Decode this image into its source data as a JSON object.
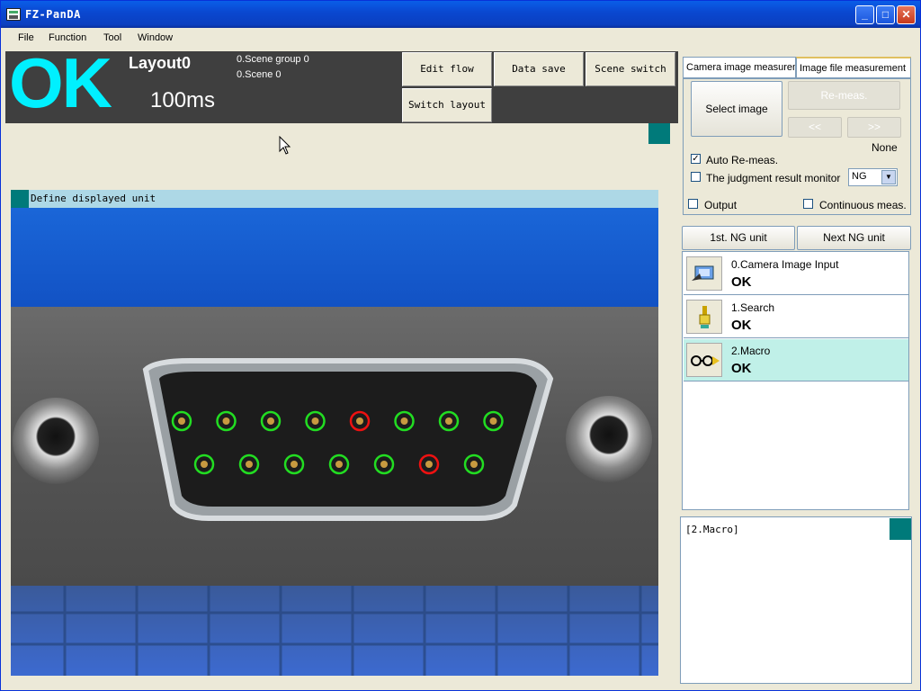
{
  "window": {
    "title": "FZ-PanDA",
    "min": "_",
    "max": "□",
    "close": "✕"
  },
  "menu": [
    "File",
    "Function",
    "Tool",
    "Window"
  ],
  "status": {
    "judgement": "OK",
    "layout": "Layout0",
    "time": "100ms",
    "scene_group": "0.Scene group 0",
    "scene": "0.Scene 0"
  },
  "toolbar": {
    "edit_flow": "Edit flow",
    "data_save": "Data save",
    "scene_switch": "Scene switch",
    "switch_layout": "Switch layout"
  },
  "image_window": {
    "title": "Define displayed unit"
  },
  "measure_tabs": [
    "Camera image measurement",
    "Image file measurement"
  ],
  "image_file_panel": {
    "select_image": "Select image",
    "re_meas": "Re-meas.",
    "prev": "<<",
    "next": ">>",
    "file_name": "None",
    "auto_remeas": "Auto Re-meas.",
    "auto_remeas_checked": true,
    "judgment_monitor": "The judgment result monitor",
    "judgment_monitor_checked": false,
    "judgment_value": "NG"
  },
  "output": {
    "label": "Output",
    "checked": false
  },
  "continuous": {
    "label": "Continuous meas.",
    "checked": false
  },
  "ng_nav": {
    "first": "1st. NG unit",
    "next": "Next NG unit"
  },
  "units": [
    {
      "name": "0.Camera Image Input",
      "result": "OK",
      "icon": "camera-input-icon"
    },
    {
      "name": "1.Search",
      "result": "OK",
      "icon": "search-unit-icon"
    },
    {
      "name": "2.Macro",
      "result": "OK",
      "icon": "macro-icon"
    }
  ],
  "detail": {
    "title": "[2.Macro]"
  },
  "pins": {
    "top": [
      "ok",
      "ok",
      "ok",
      "ok",
      "ng",
      "ok",
      "ok",
      "ok"
    ],
    "bottom": [
      "ok",
      "ok",
      "ok",
      "ok",
      "ok",
      "ng",
      "ok"
    ]
  },
  "colors": {
    "ok_ring": "#22dd22",
    "ng_ring": "#ee1111",
    "ok_text": "#00f0ff",
    "accent": "#007a7a"
  }
}
